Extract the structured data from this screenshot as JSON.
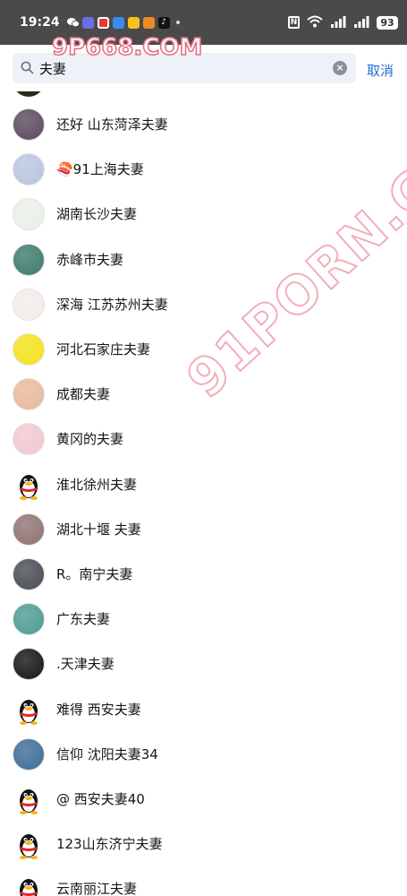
{
  "status_bar": {
    "time": "19:24",
    "battery": "93",
    "icons": [
      "wechat-icon",
      "app-icon",
      "app-icon",
      "qq-icon",
      "app-icon",
      "app-icon",
      "tiktok-icon",
      "nfc-icon",
      "wifi-icon",
      "signal-icon",
      "signal-icon",
      "battery-icon"
    ]
  },
  "watermark": {
    "top": "9P668.COM",
    "diagonal": "91PORN.COM"
  },
  "search": {
    "value": "夫妻",
    "cancel_label": "取消"
  },
  "results": [
    {
      "name": "还好 山东菏泽夫妻",
      "avatar": "anime-girl",
      "bg": "#5b4a5e"
    },
    {
      "name": "🍣91上海夫妻",
      "avatar": "photo",
      "bg": "#b9c4de"
    },
    {
      "name": "湖南长沙夫妻",
      "avatar": "cartoon-boy",
      "bg": "#e9efe6"
    },
    {
      "name": "赤峰市夫妻",
      "avatar": "flower",
      "bg": "#3f7a6e"
    },
    {
      "name": "深海 江苏苏州夫妻",
      "avatar": "doodle",
      "bg": "#f3ece9"
    },
    {
      "name": "河北石家庄夫妻",
      "avatar": "mouse",
      "bg": "#f5e11b"
    },
    {
      "name": "成都夫妻",
      "avatar": "skin",
      "bg": "#e8b99c"
    },
    {
      "name": "黄冈的夫妻",
      "avatar": "pink",
      "bg": "#f1c8cf"
    },
    {
      "name": "淮北徐州夫妻",
      "avatar": "qq-penguin",
      "bg": "#ffffff"
    },
    {
      "name": "湖北十堰 夫妻",
      "avatar": "photo",
      "bg": "#8f7372"
    },
    {
      "name": "R。南宁夫妻",
      "avatar": "car",
      "bg": "#494d54"
    },
    {
      "name": "广东夫妻",
      "avatar": "sea",
      "bg": "#4e9c92"
    },
    {
      "name": ".天津夫妻",
      "avatar": "dark",
      "bg": "#161616"
    },
    {
      "name": "难得  西安夫妻",
      "avatar": "qq-penguin",
      "bg": "#ffffff"
    },
    {
      "name": "信仰 沈阳夫妻34",
      "avatar": "landscape",
      "bg": "#3d6d96"
    },
    {
      "name": "@ 西安夫妻40",
      "avatar": "qq-penguin",
      "bg": "#ffffff"
    },
    {
      "name": "123山东济宁夫妻",
      "avatar": "qq-penguin",
      "bg": "#ffffff"
    },
    {
      "name": "云南丽江夫妻",
      "avatar": "qq-penguin",
      "bg": "#ffffff"
    }
  ]
}
